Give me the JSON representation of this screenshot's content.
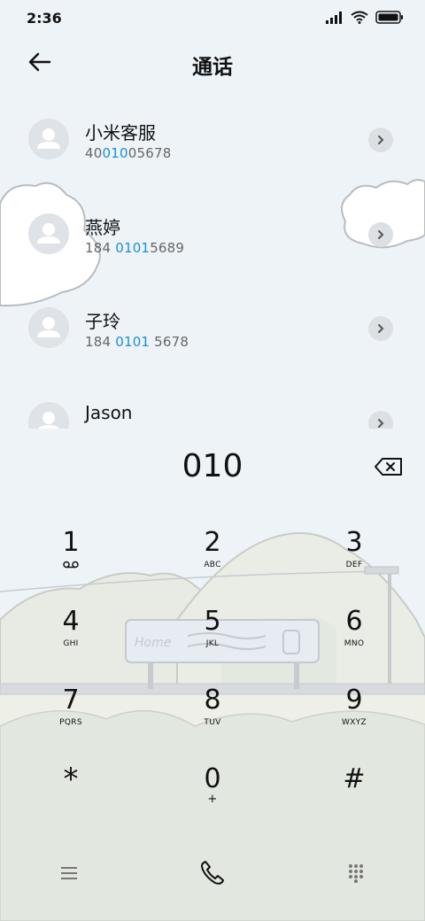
{
  "status": {
    "time": "2:36"
  },
  "header": {
    "title": "通话"
  },
  "contacts": [
    {
      "name": "小米客服",
      "number_pre": "40",
      "number_match": "010",
      "number_post": "05678"
    },
    {
      "name": "燕婷",
      "number_pre": "184 ",
      "number_match": "0101",
      "number_post": "5689"
    },
    {
      "name": "子玲",
      "number_pre": "184 ",
      "number_match": "0101",
      "number_post": " 5678"
    },
    {
      "name": "Jason",
      "number_pre": "",
      "number_match": "",
      "number_post": ""
    }
  ],
  "dialer": {
    "dialed": "010"
  },
  "keypad": {
    "keys": [
      {
        "digit": "1",
        "letters": ""
      },
      {
        "digit": "2",
        "letters": "ABC"
      },
      {
        "digit": "3",
        "letters": "DEF"
      },
      {
        "digit": "4",
        "letters": "GHI"
      },
      {
        "digit": "5",
        "letters": "JKL"
      },
      {
        "digit": "6",
        "letters": "MNO"
      },
      {
        "digit": "7",
        "letters": "PQRS"
      },
      {
        "digit": "8",
        "letters": "TUV"
      },
      {
        "digit": "9",
        "letters": "WXYZ"
      },
      {
        "digit": "*",
        "letters": ""
      },
      {
        "digit": "0",
        "letters": "+"
      },
      {
        "digit": "#",
        "letters": ""
      }
    ]
  },
  "wallpaper": {
    "sign_text": "Home"
  },
  "icons": {
    "back": "arrow-left-icon",
    "backspace": "backspace-icon",
    "voicemail": "voicemail-icon",
    "menu": "menu-icon",
    "call": "phone-icon",
    "keypad_toggle": "dialpad-icon"
  },
  "colors": {
    "match_highlight": "#1a8fd6",
    "background": "#eef3f8"
  }
}
